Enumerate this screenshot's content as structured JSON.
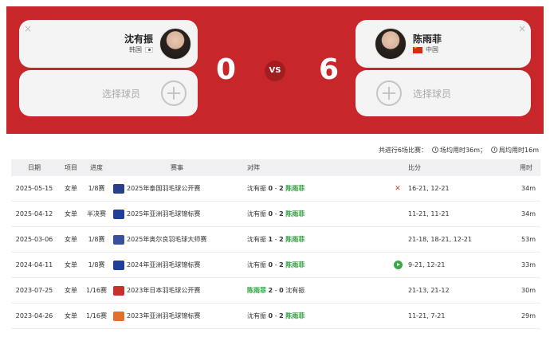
{
  "left_player": {
    "name": "沈有振",
    "country": "韩国",
    "score": "0"
  },
  "right_player": {
    "name": "陈雨菲",
    "country": "中国",
    "score": "6"
  },
  "vs_label": "VS",
  "select_player_label": "选择球员",
  "close_icon": "×",
  "summary": {
    "total": "共进行6场比赛：",
    "avg_match": "场均用时36m；",
    "avg_game": "局均用时16m"
  },
  "table": {
    "headers": {
      "date": "日期",
      "type": "项目",
      "round": "进度",
      "event": "赛事",
      "match": "对阵",
      "score": "比分",
      "time": "用时"
    },
    "rows": [
      {
        "date": "2025-05-15",
        "type": "女单",
        "round": "1/8赛",
        "event": "2025年泰国羽毛球公开赛",
        "logo_color": "#2a3e8c",
        "p1": "沈有振",
        "s1": "0",
        "sep": "-",
        "s2": "2",
        "p2": "陈雨菲",
        "winner": "p2",
        "icon": "crossed-rackets-icon",
        "score": "16-21, 12-21",
        "time": "34m"
      },
      {
        "date": "2025-04-12",
        "type": "女单",
        "round": "半决赛",
        "event": "2025年亚洲羽毛球锦标赛",
        "logo_color": "#1f3f9a",
        "p1": "沈有振",
        "s1": "0",
        "sep": "-",
        "s2": "2",
        "p2": "陈雨菲",
        "winner": "p2",
        "icon": "",
        "score": "11-21, 11-21",
        "time": "34m"
      },
      {
        "date": "2025-03-06",
        "type": "女单",
        "round": "1/8赛",
        "event": "2025年奥尔良羽毛球大师赛",
        "logo_color": "#3b4f9e",
        "p1": "沈有振",
        "s1": "1",
        "sep": "-",
        "s2": "2",
        "p2": "陈雨菲",
        "winner": "p2",
        "icon": "",
        "score": "21-18, 18-21, 12-21",
        "time": "53m"
      },
      {
        "date": "2024-04-11",
        "type": "女单",
        "round": "1/8赛",
        "event": "2024年亚洲羽毛球锦标赛",
        "logo_color": "#1f3f9a",
        "p1": "沈有振",
        "s1": "0",
        "sep": "-",
        "s2": "2",
        "p2": "陈雨菲",
        "winner": "p2",
        "icon": "play-icon",
        "score": "9-21, 12-21",
        "time": "33m"
      },
      {
        "date": "2023-07-25",
        "type": "女单",
        "round": "1/16赛",
        "event": "2023年日本羽毛球公开赛",
        "logo_color": "#c9302c",
        "p1": "陈雨菲",
        "s1": "2",
        "sep": "-",
        "s2": "0",
        "p2": "沈有振",
        "winner": "p1",
        "icon": "",
        "score": "21-13, 21-12",
        "time": "30m"
      },
      {
        "date": "2023-04-26",
        "type": "女单",
        "round": "1/16赛",
        "event": "2023年亚洲羽毛球锦标赛",
        "logo_color": "#e0702a",
        "p1": "沈有振",
        "s1": "0",
        "sep": "-",
        "s2": "2",
        "p2": "陈雨菲",
        "winner": "p2",
        "icon": "",
        "score": "11-21, 7-21",
        "time": "29m"
      }
    ]
  }
}
